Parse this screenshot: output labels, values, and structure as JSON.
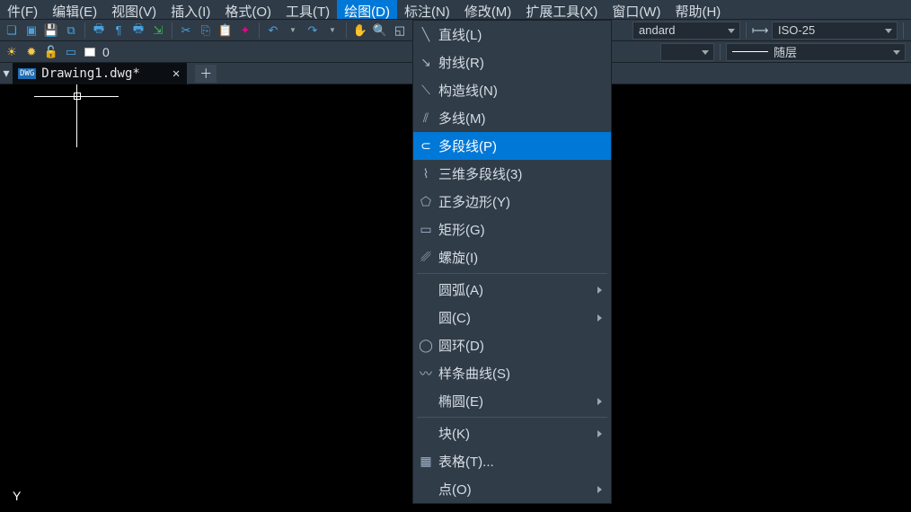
{
  "menubar": {
    "items": [
      {
        "label": "件(F)"
      },
      {
        "label": "编辑(E)"
      },
      {
        "label": "视图(V)"
      },
      {
        "label": "插入(I)"
      },
      {
        "label": "格式(O)"
      },
      {
        "label": "工具(T)"
      },
      {
        "label": "绘图(D)",
        "open": true
      },
      {
        "label": "标注(N)"
      },
      {
        "label": "修改(M)"
      },
      {
        "label": "扩展工具(X)"
      },
      {
        "label": "窗口(W)"
      },
      {
        "label": "帮助(H)"
      }
    ]
  },
  "toolbar1": {
    "combos": {
      "style": "andard",
      "dim": "ISO-25"
    }
  },
  "toolbar2": {
    "layer_num": "0",
    "linetype": "随层"
  },
  "tabs": {
    "current": "Drawing1.dwg*"
  },
  "dropdown": {
    "items": [
      {
        "label": "直线(L)",
        "icon": "line"
      },
      {
        "label": "射线(R)",
        "icon": "ray"
      },
      {
        "label": "构造线(N)",
        "icon": "xline"
      },
      {
        "label": "多线(M)",
        "icon": "mline"
      },
      {
        "label": "多段线(P)",
        "icon": "pline",
        "highlight": true
      },
      {
        "label": "三维多段线(3)",
        "icon": "3dpl"
      },
      {
        "label": "正多边形(Y)",
        "icon": "polygon"
      },
      {
        "label": "矩形(G)",
        "icon": "rect"
      },
      {
        "label": "螺旋(I)",
        "icon": "helix"
      },
      {
        "sep": true
      },
      {
        "label": "圆弧(A)",
        "sub": true
      },
      {
        "label": "圆(C)",
        "sub": true
      },
      {
        "label": "圆环(D)",
        "icon": "donut"
      },
      {
        "label": "样条曲线(S)",
        "icon": "spline"
      },
      {
        "label": "椭圆(E)",
        "sub": true
      },
      {
        "sep": true
      },
      {
        "label": "块(K)",
        "sub": true
      },
      {
        "label": "表格(T)...",
        "icon": "table"
      },
      {
        "label": "点(O)",
        "sub": true
      }
    ]
  },
  "ucs_label": "Y"
}
